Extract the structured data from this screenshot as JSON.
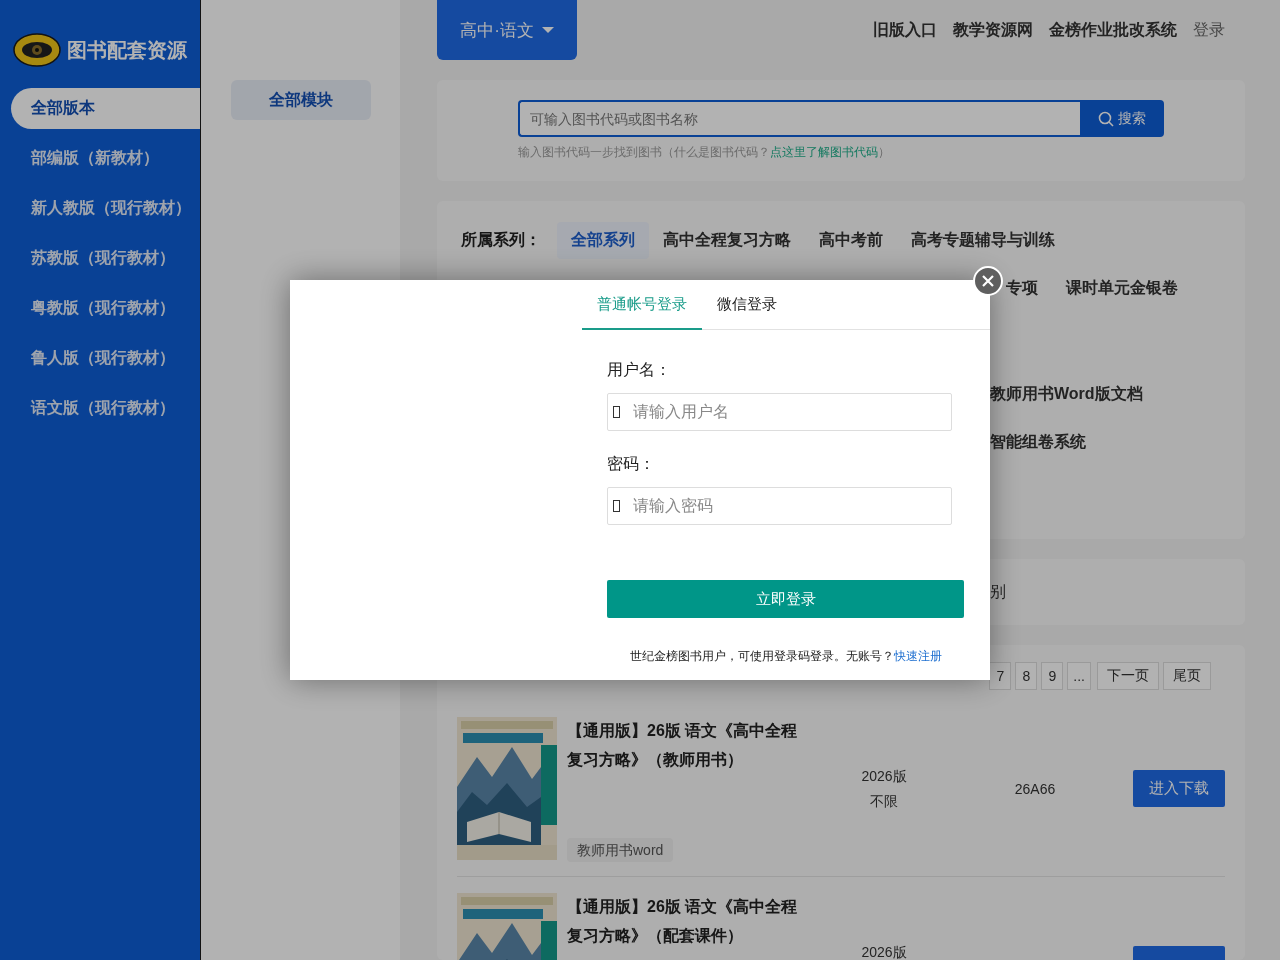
{
  "sidebar": {
    "title": "图书配套资源",
    "items": [
      {
        "label": "全部版本",
        "selected": true
      },
      {
        "label": "部编版（新教材）",
        "selected": false
      },
      {
        "label": "新人教版（现行教材）",
        "selected": false
      },
      {
        "label": "苏教版（现行教材）",
        "selected": false
      },
      {
        "label": "粤教版（现行教材）",
        "selected": false
      },
      {
        "label": "鲁人版（现行教材）",
        "selected": false
      },
      {
        "label": "语文版（现行教材）",
        "selected": false
      }
    ]
  },
  "module_button": "全部模块",
  "header": {
    "subject": "高中·语文",
    "links": [
      {
        "label": "旧版入口",
        "kind": "strong"
      },
      {
        "label": "教学资源网",
        "kind": "strong"
      },
      {
        "label": "金榜作业批改系统",
        "kind": "strong"
      },
      {
        "label": "登录",
        "kind": "plain"
      }
    ]
  },
  "search": {
    "placeholder": "可输入图书代码或图书名称",
    "button": "搜索",
    "hint": "输入图书代码一步找到图书（什么是图书代码？",
    "hint_link": "点这里了解图书代码",
    "hint_end": "）"
  },
  "filters": {
    "label": "所属系列：",
    "series": [
      {
        "label": "全部系列",
        "selected": true
      },
      {
        "label": "高中全程复习方略",
        "selected": false
      },
      {
        "label": "高中考前",
        "selected": false
      },
      {
        "label": "高考专题辅导与训练",
        "selected": false
      }
    ],
    "series_row_2": [
      {
        "label": "专项",
        "selected": false
      },
      {
        "label": "课时单元金银卷",
        "selected": false
      }
    ],
    "other_options": [
      {
        "label": "教师用书Word版文档",
        "selected": false
      },
      {
        "label": "智能组卷系统",
        "selected": false
      }
    ]
  },
  "sort_bar_fragment": "别",
  "pagination": {
    "pages": [
      {
        "label": "7",
        "selected": false
      },
      {
        "label": "8",
        "selected": false
      },
      {
        "label": "9",
        "selected": false
      },
      {
        "label": "...",
        "selected": false
      }
    ],
    "next": "下一页",
    "last": "尾页"
  },
  "books": [
    {
      "title": "【通用版】26版 语文《高中全程复习方略》（教师用书）",
      "edition": "2026版",
      "limit": "不限",
      "code": "26A66",
      "action": "进入下载",
      "tags": [
        "教师用书word"
      ]
    },
    {
      "title": "【通用版】26版 语文《高中全程复习方略》（配套课件）",
      "edition": "2026版"
    }
  ],
  "login": {
    "tabs": [
      {
        "label": "普通帐号登录",
        "selected": true
      },
      {
        "label": "微信登录",
        "selected": false
      }
    ],
    "fields": [
      {
        "label": "用户名：",
        "placeholder": "请输入用户名"
      },
      {
        "label": "密码：",
        "placeholder": "请输入密码"
      }
    ],
    "submit": "立即登录",
    "note": "世纪金榜图书用户，可使用登录码登录。无账号？",
    "register_link": "快速注册"
  }
}
